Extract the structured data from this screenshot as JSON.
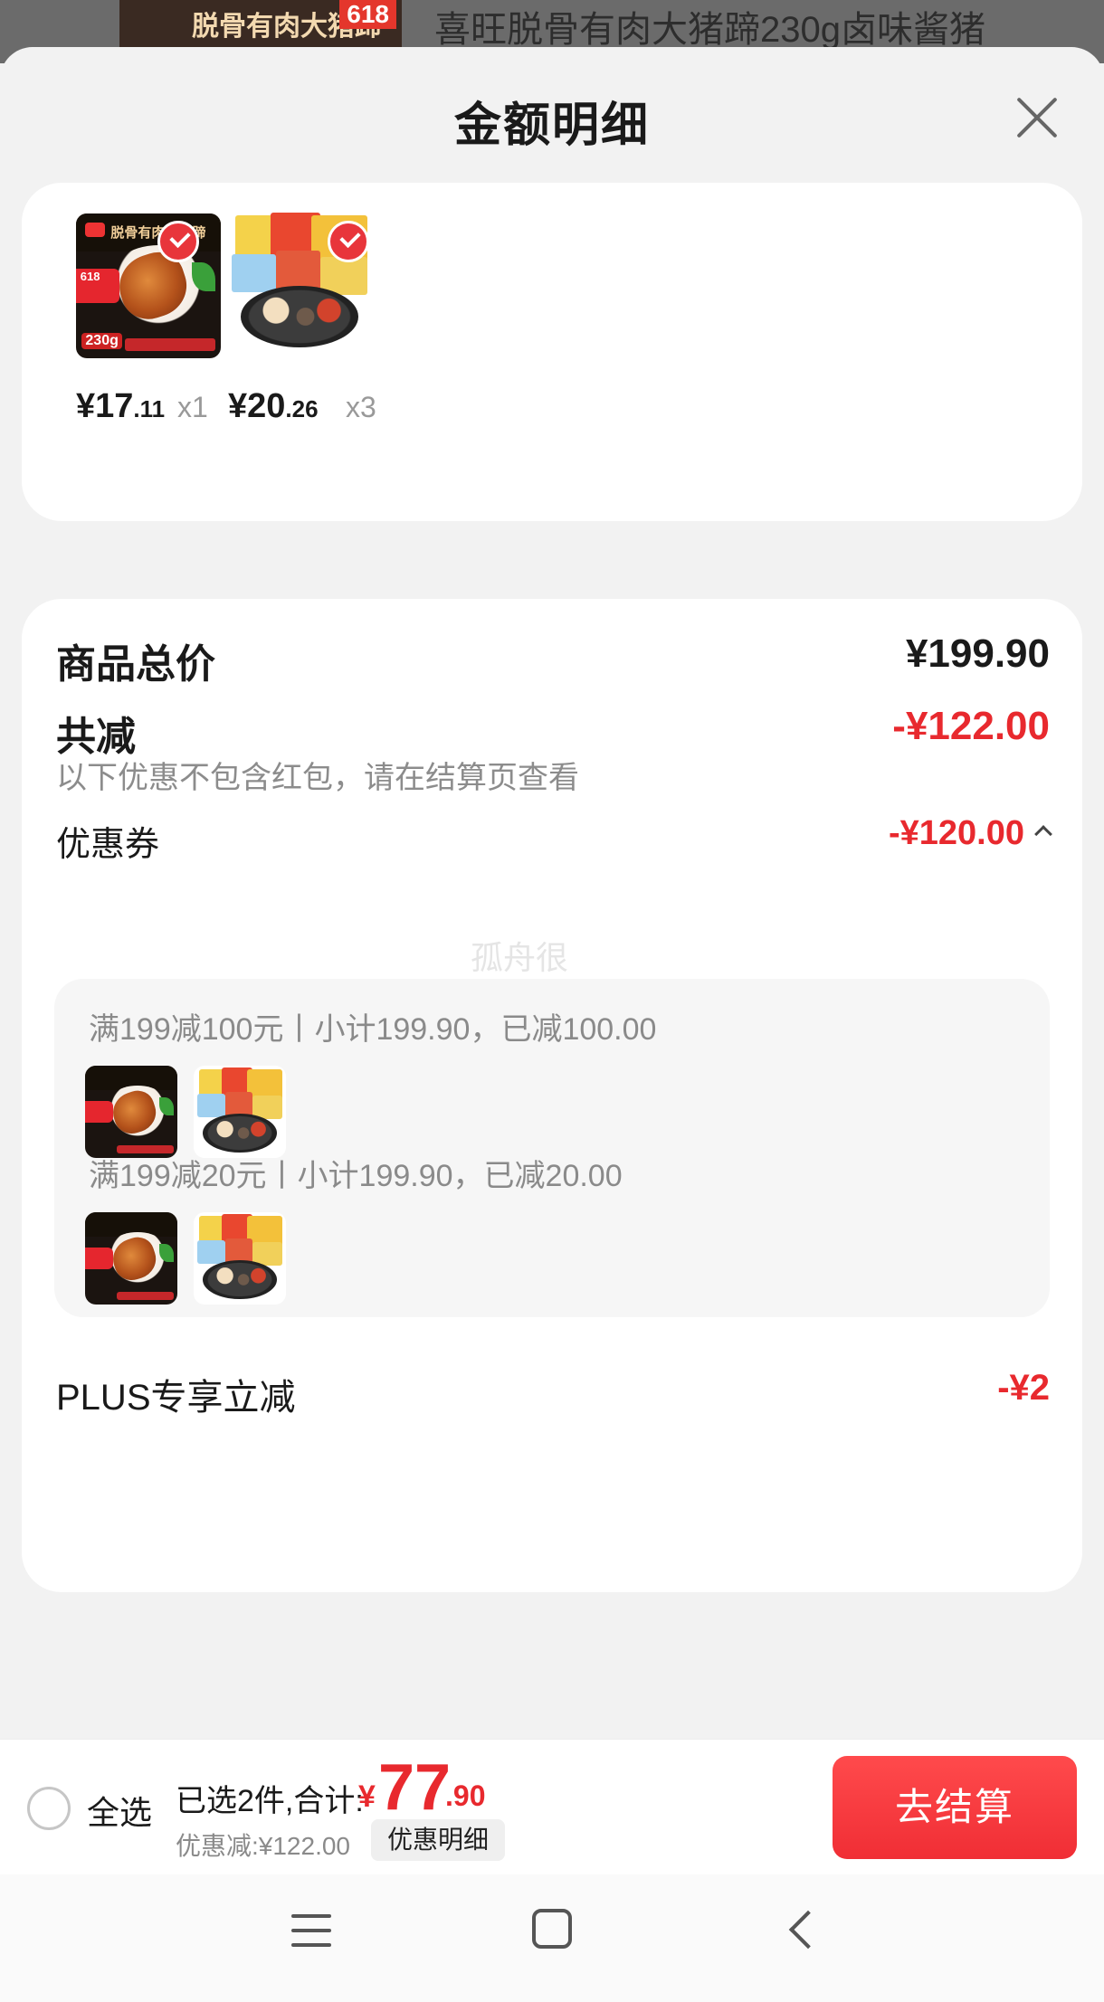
{
  "background_page": {
    "thumb_title": "脱骨有肉大猪蹄",
    "thumb_tag": "618",
    "product_title": "喜旺脱骨有肉大猪蹄230g卤味酱猪"
  },
  "sheet": {
    "title": "金额明细",
    "close_icon": "close-icon"
  },
  "items": [
    {
      "name_on_image": "脱骨有肉大猪蹄",
      "badge": "618",
      "weight": "230g",
      "price_int": "¥17",
      "price_dec": ".11",
      "qty": "x1",
      "selected": true
    },
    {
      "name_on_image": "",
      "price_int": "¥20",
      "price_dec": ".26",
      "qty": "x3",
      "selected": true
    }
  ],
  "detail": {
    "total_label": "商品总价",
    "total_value": "¥199.90",
    "reduce_label": "共减",
    "reduce_value": "-¥122.00",
    "reduce_note": "以下优惠不包含红包，请在结算页查看",
    "coupon_label": "优惠券",
    "coupon_value": "-¥120.00",
    "watermark": "孤舟很",
    "coupons": [
      {
        "text": "满199减100元丨小计199.90，已减100.00"
      },
      {
        "text": "满199减20元丨小计199.90，已减20.00"
      }
    ],
    "plus_label": "PLUS专享立减",
    "plus_value": "-¥2"
  },
  "bottom_bar": {
    "select_all": "全选",
    "summary": "已选2件,合计:",
    "total_yen": "¥",
    "total_int": "77",
    "total_dec": ".90",
    "discount": "优惠减:¥122.00",
    "detail_button": "优惠明细",
    "checkout": "去结算"
  },
  "colors": {
    "accent_red": "#e8292e",
    "checkout_red": "#f02e35",
    "sheet_bg": "#f2f2f2"
  }
}
